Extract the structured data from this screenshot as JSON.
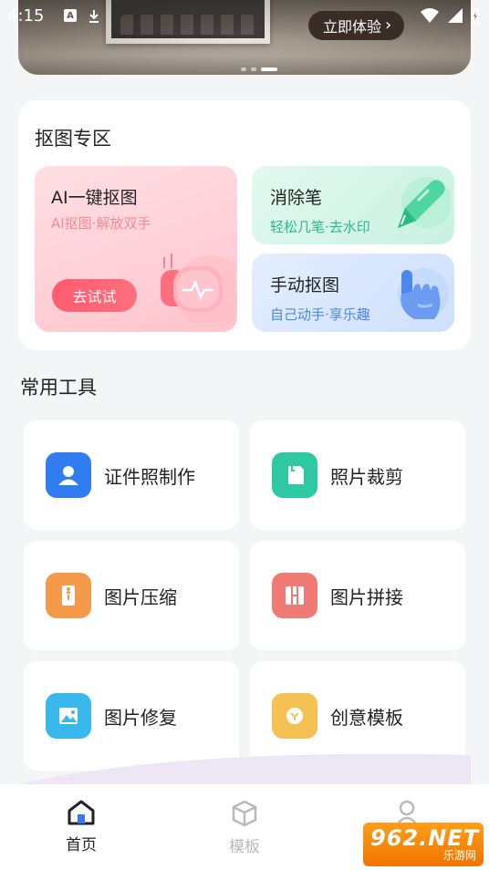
{
  "status_bar": {
    "time": "4:15"
  },
  "banner": {
    "cta_label": "立即体验"
  },
  "cutout": {
    "title": "抠图专区",
    "ai": {
      "title": "AI一键抠图",
      "subtitle": "AI抠图·解放双手",
      "button": "去试试"
    },
    "eraser": {
      "title": "消除笔",
      "subtitle": "轻松几笔·去水印"
    },
    "manual": {
      "title": "手动抠图",
      "subtitle": "自己动手·享乐趣"
    }
  },
  "tools": {
    "title": "常用工具",
    "items": [
      {
        "label": "证件照制作",
        "icon": "id-photo-icon",
        "color": "#2f7df0"
      },
      {
        "label": "照片裁剪",
        "icon": "crop-icon",
        "color": "#2ec9a2"
      },
      {
        "label": "图片压缩",
        "icon": "compress-icon",
        "color": "#f39b4b"
      },
      {
        "label": "图片拼接",
        "icon": "collage-icon",
        "color": "#f07b74"
      },
      {
        "label": "图片修复",
        "icon": "repair-icon",
        "color": "#38b8ec"
      },
      {
        "label": "创意模板",
        "icon": "template-icon",
        "color": "#f4c152"
      }
    ]
  },
  "nav": {
    "items": [
      {
        "label": "首页",
        "icon": "home-icon",
        "active": true
      },
      {
        "label": "模板",
        "icon": "cube-icon",
        "active": false
      },
      {
        "label": "",
        "icon": "user-icon",
        "active": false
      }
    ]
  },
  "watermark": {
    "brand": "962.NET",
    "sub": "乐游网"
  },
  "colors": {
    "accent_red": "#ff5b6e",
    "eraser_green": "#2fb886",
    "manual_blue": "#4b86e8"
  }
}
